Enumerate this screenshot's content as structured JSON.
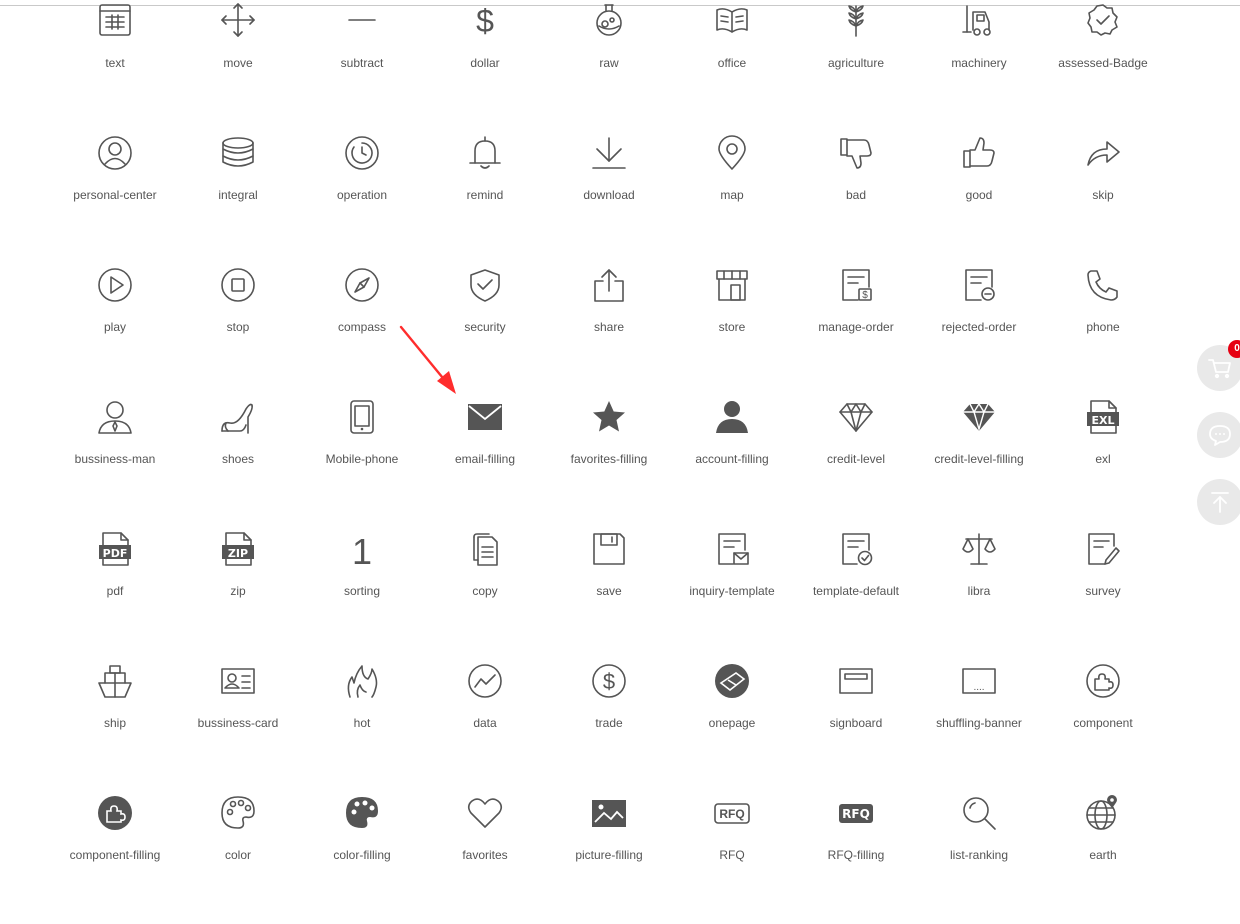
{
  "icons": [
    [
      "text",
      "move",
      "subtract",
      "dollar",
      "raw",
      "office",
      "agriculture",
      "machinery",
      "assessed-Badge"
    ],
    [
      "personal-center",
      "integral",
      "operation",
      "remind",
      "download",
      "map",
      "bad",
      "good",
      "skip"
    ],
    [
      "play",
      "stop",
      "compass",
      "security",
      "share",
      "store",
      "manage-order",
      "rejected-order",
      "phone"
    ],
    [
      "bussiness-man",
      "shoes",
      "Mobile-phone",
      "email-filling",
      "favorites-filling",
      "account-filling",
      "credit-level",
      "credit-level-filling",
      "exl"
    ],
    [
      "pdf",
      "zip",
      "sorting",
      "copy",
      "save",
      "inquiry-template",
      "template-default",
      "libra",
      "survey"
    ],
    [
      "ship",
      "bussiness-card",
      "hot",
      "data",
      "trade",
      "onepage",
      "signboard",
      "shuffling-banner",
      "component"
    ],
    [
      "component-filling",
      "color",
      "color-filling",
      "favorites",
      "picture-filling",
      "RFQ",
      "RFQ-filling",
      "list-ranking",
      "earth"
    ]
  ],
  "glyph_text": {
    "exl": "EXL",
    "pdf": "PDF",
    "zip": "ZIP",
    "sorting": "1",
    "dollar": "$",
    "trade": "$",
    "rfq": "RFQ",
    "shuffling": "....",
    "manage_order": "$"
  },
  "sidebar": {
    "cart_count": "0",
    "cart_icon": "cart-icon",
    "chat_icon": "chat-icon",
    "top_icon": "back-to-top-icon"
  },
  "colors": {
    "icon": "#555555",
    "label": "#555555",
    "annotation_arrow": "#ff2d2d",
    "badge": "#e60012",
    "side_button": "#e9e9e9"
  }
}
